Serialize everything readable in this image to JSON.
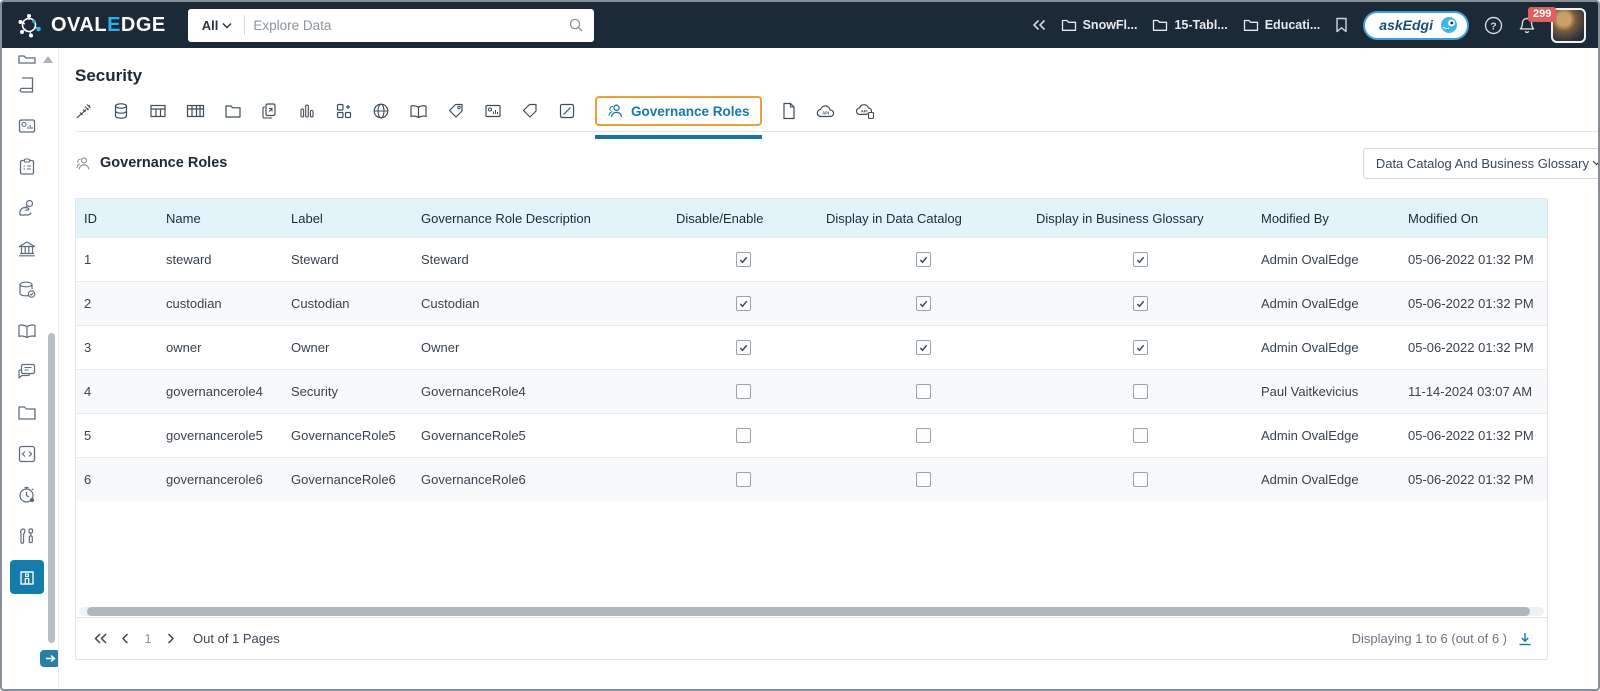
{
  "topbar": {
    "brand": {
      "wordmark_pre": "OVAL",
      "wordmark_accent": "E",
      "wordmark_post": "DGE"
    },
    "search": {
      "scope_label": "All",
      "placeholder": "Explore Data"
    },
    "breadcrumbs": [
      {
        "label": "SnowFl..."
      },
      {
        "label": "15-Tabl..."
      },
      {
        "label": "Educati..."
      }
    ],
    "askedgi_label": "askEdgi",
    "notification_badge": "299"
  },
  "page": {
    "title": "Security"
  },
  "tabs": {
    "active_label": "Governance Roles"
  },
  "section": {
    "title": "Governance Roles",
    "dropdown_label": "Data Catalog And Business Glossary"
  },
  "table": {
    "columns": [
      "ID",
      "Name",
      "Label",
      "Governance Role Description",
      "Disable/Enable",
      "Display in Data Catalog",
      "Display in Business Glossary",
      "Modified By",
      "Modified On"
    ],
    "rows": [
      {
        "id": "1",
        "name": "steward",
        "label": "Steward",
        "description": "Steward",
        "disable_enable": true,
        "display_data_catalog": true,
        "display_business_glossary": true,
        "modified_by": "Admin OvalEdge",
        "modified_on": "05-06-2022 01:32 PM"
      },
      {
        "id": "2",
        "name": "custodian",
        "label": "Custodian",
        "description": "Custodian",
        "disable_enable": true,
        "display_data_catalog": true,
        "display_business_glossary": true,
        "modified_by": "Admin OvalEdge",
        "modified_on": "05-06-2022 01:32 PM"
      },
      {
        "id": "3",
        "name": "owner",
        "label": "Owner",
        "description": "Owner",
        "disable_enable": true,
        "display_data_catalog": true,
        "display_business_glossary": true,
        "modified_by": "Admin OvalEdge",
        "modified_on": "05-06-2022 01:32 PM"
      },
      {
        "id": "4",
        "name": "governancerole4",
        "label": "Security",
        "description": "GovernanceRole4",
        "disable_enable": false,
        "display_data_catalog": false,
        "display_business_glossary": false,
        "modified_by": "Paul Vaitkevicius",
        "modified_on": "11-14-2024 03:07 AM"
      },
      {
        "id": "5",
        "name": "governancerole5",
        "label": "GovernanceRole5",
        "description": "GovernanceRole5",
        "disable_enable": false,
        "display_data_catalog": false,
        "display_business_glossary": false,
        "modified_by": "Admin OvalEdge",
        "modified_on": "05-06-2022 01:32 PM"
      },
      {
        "id": "6",
        "name": "governancerole6",
        "label": "GovernanceRole6",
        "description": "GovernanceRole6",
        "disable_enable": false,
        "display_data_catalog": false,
        "display_business_glossary": false,
        "modified_by": "Admin OvalEdge",
        "modified_on": "05-06-2022 01:32 PM"
      }
    ]
  },
  "footer": {
    "current_page": "1",
    "pages_label": "Out of 1 Pages",
    "displaying_label": "Displaying 1 to 6  (out of 6 )"
  },
  "colors": {
    "navbar_bg": "#1c2a37",
    "accent_teal": "#1679a7",
    "highlight_orange": "#e9a13b",
    "badge_red": "#e0605d",
    "table_header_bg": "#e2f4fa",
    "active_sidebar_bg": "#147cab"
  }
}
